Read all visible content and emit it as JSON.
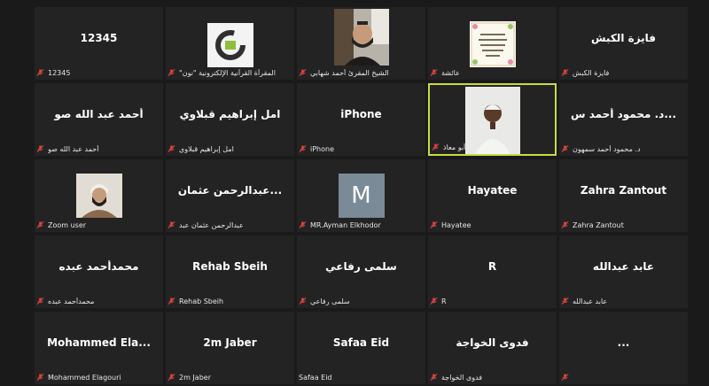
{
  "tiles": [
    {
      "center": "12345",
      "label": "12345"
    },
    {
      "center": "",
      "label": "\"المقرأة القرآنية الإلكترونية \"نون"
    },
    {
      "center": "",
      "label": "الشيخ المقرئ أحمد شهابي"
    },
    {
      "center": "",
      "label": "عائشة"
    },
    {
      "center": "فايزة الكبش",
      "label": "فايزة الكبش"
    },
    {
      "center": "أحمد عبد الله صو",
      "label": "أحمد عبد الله صو"
    },
    {
      "center": "امل إبراهيم قبلاوي",
      "label": "امل إبراهيم قبلاوي"
    },
    {
      "center": "iPhone",
      "label": "iPhone"
    },
    {
      "center": "",
      "label": "أبو معاذ"
    },
    {
      "center": "د. محمود أحمد س...",
      "label": "د. محمود أحمد سمهون"
    },
    {
      "center": "",
      "label": "Zoom user"
    },
    {
      "center": "عبدالرحمن عثمان...",
      "label": "عبدالرحمن عثمان عبد"
    },
    {
      "center": "",
      "avatar_letter": "M",
      "label": "MR.Ayman Elkhodor"
    },
    {
      "center": "Hayatee",
      "label": "Hayatee"
    },
    {
      "center": "Zahra Zantout",
      "label": "Zahra Zantout"
    },
    {
      "center": "محمدأحمد عبده",
      "label": "محمدأحمد عبده"
    },
    {
      "center": "Rehab Sbeih",
      "label": "Rehab Sbeih"
    },
    {
      "center": "سلمى رفاعي",
      "label": "سلمى رفاعي"
    },
    {
      "center": "R",
      "label": "R"
    },
    {
      "center": "عابد عبدالله",
      "label": "عابد عبدالله"
    },
    {
      "center": "Mohammed  Ela...",
      "label": "Mohammed Elagouri"
    },
    {
      "center": "2m Jaber",
      "label": "2m Jaber"
    },
    {
      "center": "Safaa Eid",
      "label": "Safaa Eid"
    },
    {
      "center": "فدوى الخواجة",
      "label": "فدوى الخواجة"
    },
    {
      "center": "...",
      "label": ""
    }
  ],
  "colors": {
    "speaking_border": "#c9dc3c",
    "muted_mic": "#e0443e",
    "avatar_bg": "#7a8a96"
  },
  "icons": {
    "muted": "muted-mic-icon"
  }
}
